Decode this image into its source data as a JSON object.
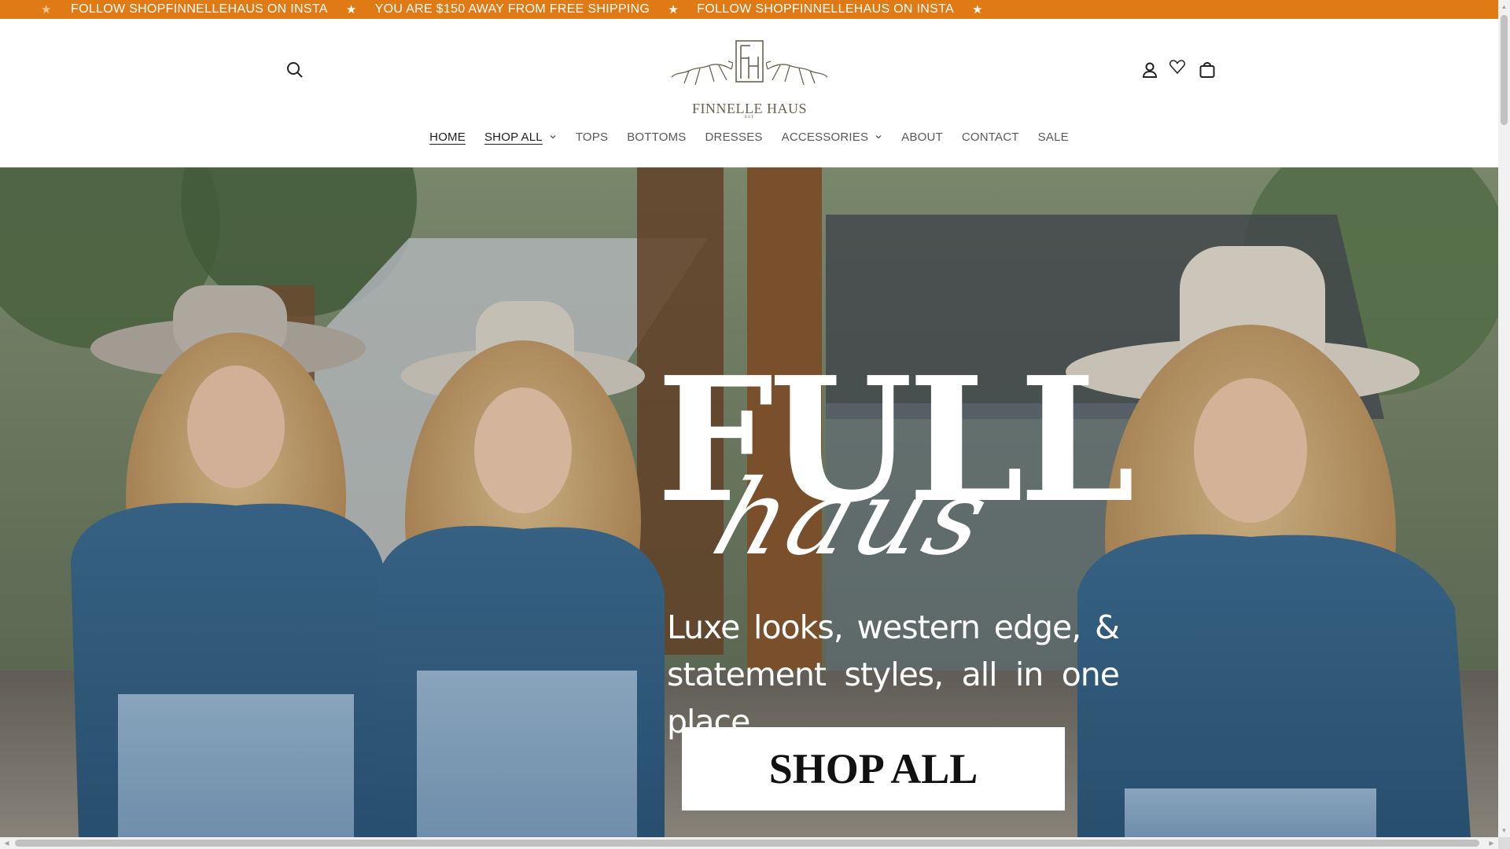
{
  "announcement": {
    "messages": [
      "FOLLOW SHOPFINNELLEHAUS ON INSTA",
      "YOU ARE $150 AWAY FROM FREE SHIPPING",
      "FOLLOW SHOPFINNELLEHAUS ON INSTA"
    ],
    "separator": "★",
    "background": "#df7a14"
  },
  "header": {
    "logo": {
      "name": "FINNELLE HAUS",
      "monogram": "FH",
      "sub": "EST"
    },
    "icons": {
      "search": "search-icon",
      "account": "account-icon",
      "wishlist": "heart-icon",
      "cart": "cart-icon"
    }
  },
  "nav": {
    "items": [
      {
        "label": "HOME",
        "active": true,
        "dropdown": false
      },
      {
        "label": "SHOP ALL",
        "active": false,
        "dropdown": true
      },
      {
        "label": "TOPS",
        "active": false,
        "dropdown": false
      },
      {
        "label": "BOTTOMS",
        "active": false,
        "dropdown": false
      },
      {
        "label": "DRESSES",
        "active": false,
        "dropdown": false
      },
      {
        "label": "ACCESSORIES",
        "active": false,
        "dropdown": true
      },
      {
        "label": "ABOUT",
        "active": false,
        "dropdown": false
      },
      {
        "label": "CONTACT",
        "active": false,
        "dropdown": false
      },
      {
        "label": "SALE",
        "active": false,
        "dropdown": false
      }
    ]
  },
  "hero": {
    "title": "FULL",
    "script": "haus",
    "tagline": "Luxe looks, western edge, & statement styles, all in one place.",
    "cta_label": "SHOP ALL"
  },
  "colors": {
    "accent": "#df7a14",
    "nav_text": "#5a5a5a",
    "logo_text": "#6b6352"
  }
}
